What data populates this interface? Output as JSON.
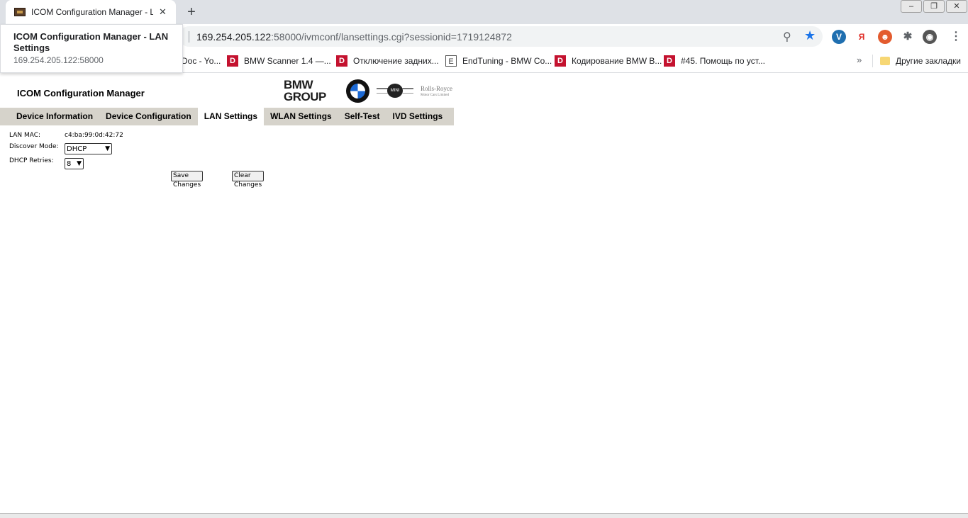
{
  "browser": {
    "tab_title": "ICOM Configuration Manager - LAN Settings",
    "new_tab": "+",
    "close": "✕",
    "address": {
      "host": "169.254.205.122",
      "path": ":58000/ivmconf/lansettings.cgi?sessionid=1719124872"
    },
    "tooltip": {
      "title": "ICOM Configuration Manager - LAN Settings",
      "url": "169.254.205.122:58000"
    },
    "bookmarks": [
      {
        "label": "Doc - Yo...",
        "icon": "D"
      },
      {
        "label": "BMW Scanner 1.4 —...",
        "icon": "D"
      },
      {
        "label": "Отключение задних...",
        "icon": "D"
      },
      {
        "label": "EndTuning - BMW Co...",
        "icon": "E"
      },
      {
        "label": "Кодирование BMW B...",
        "icon": "D"
      },
      {
        "label": "#45. Помощь по уст...",
        "icon": "D"
      }
    ],
    "bookmarks_more": "»",
    "other_bookmarks": "Другие закладки",
    "ext_ya": "Я"
  },
  "page": {
    "title": "ICOM Configuration Manager",
    "brand": {
      "group_line1": "BMW",
      "group_line2": "GROUP",
      "mini": "MINI",
      "rr_line1": "Rolls-Royce",
      "rr_line2": "Motor Cars Limited"
    },
    "nav": [
      "Device Information",
      "Device Configuration",
      "LAN Settings",
      "WLAN Settings",
      "Self-Test",
      "IVD Settings"
    ],
    "active_nav": "LAN Settings",
    "form": {
      "lan_mac_label": "LAN MAC:",
      "lan_mac_value": "c4:ba:99:0d:42:72",
      "discover_label": "Discover Mode:",
      "discover_value": "DHCP",
      "retries_label": "DHCP Retries:",
      "retries_value": "8",
      "save_label": "Save Changes",
      "clear_label": "Clear Changes"
    }
  }
}
